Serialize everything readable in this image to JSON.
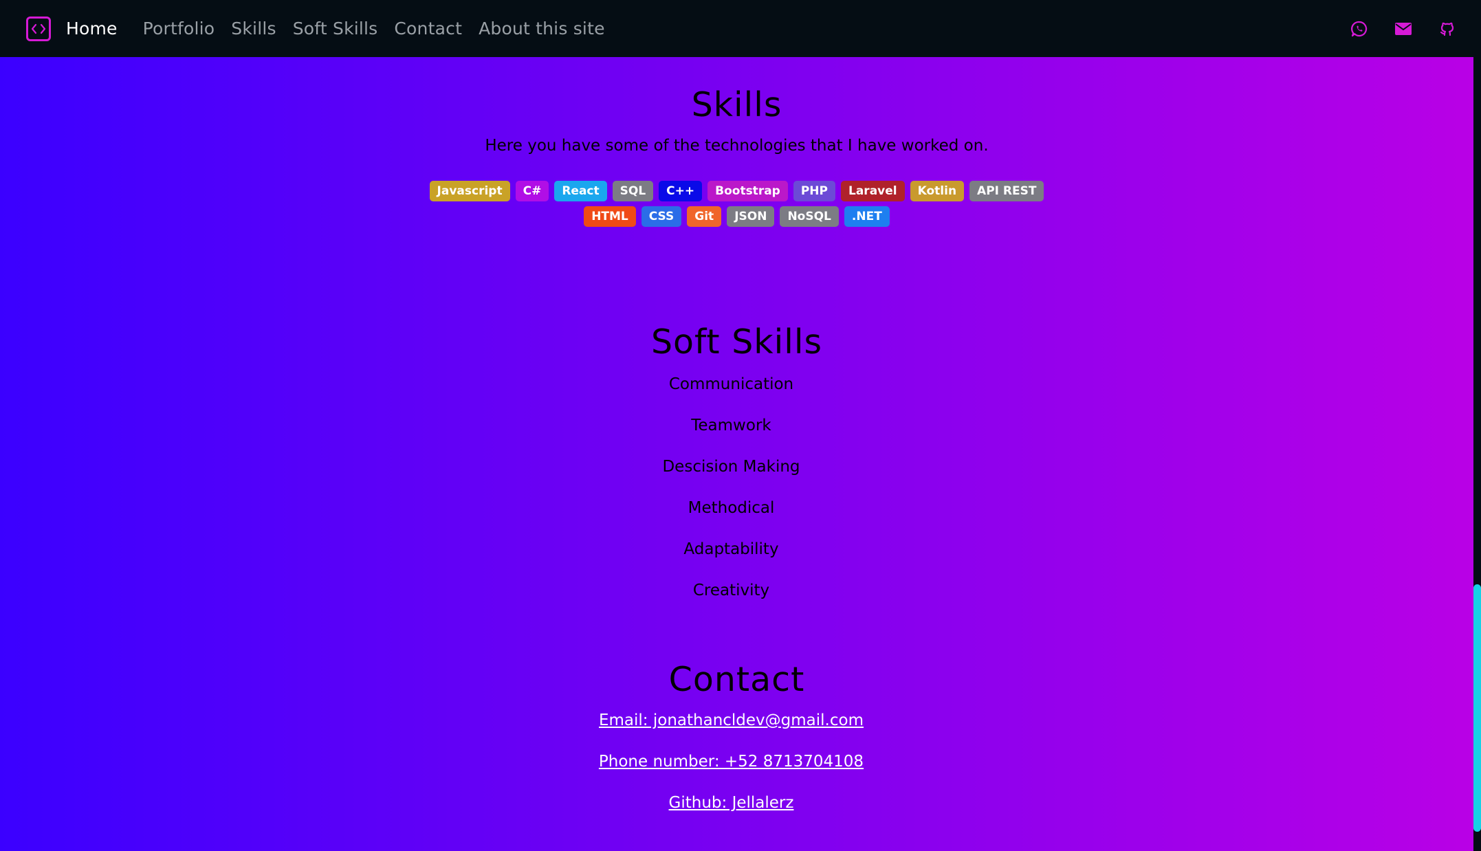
{
  "navbar": {
    "home": "Home",
    "links": [
      "Portfolio",
      "Skills",
      "Soft Skills",
      "Contact",
      "About this site"
    ],
    "icons": [
      "whatsapp-icon",
      "mail-icon",
      "github-icon"
    ],
    "icon_color": "#d61ad6"
  },
  "skills": {
    "title": "Skills",
    "subtitle": "Here you have some of the technologies that I have worked on.",
    "badges_row1": [
      {
        "label": "Javascript",
        "color": "#c9a227"
      },
      {
        "label": "C#",
        "color": "#b10ee6"
      },
      {
        "label": "React",
        "color": "#1aa7ee"
      },
      {
        "label": "SQL",
        "color": "#7c7c84"
      },
      {
        "label": "C++",
        "color": "#0a0ae8"
      },
      {
        "label": "Bootstrap",
        "color": "#bb18c9"
      },
      {
        "label": "PHP",
        "color": "#6c4ad6"
      },
      {
        "label": "Laravel",
        "color": "#b0222a"
      },
      {
        "label": "Kotlin",
        "color": "#c99a2e"
      },
      {
        "label": "API REST",
        "color": "#7c7c84"
      }
    ],
    "badges_row2": [
      {
        "label": "HTML",
        "color": "#f04a16"
      },
      {
        "label": "CSS",
        "color": "#2b6de8"
      },
      {
        "label": "Git",
        "color": "#f0652a"
      },
      {
        "label": "JSON",
        "color": "#7c7c84"
      },
      {
        "label": "NoSQL",
        "color": "#7c7c84"
      },
      {
        "label": ".NET",
        "color": "#1e7ff0"
      }
    ]
  },
  "soft_skills": {
    "title": "Soft Skills",
    "items": [
      "Communication",
      "Teamwork",
      "Descision Making",
      "Methodical",
      "Adaptability",
      "Creativity"
    ]
  },
  "contact": {
    "title": "Contact",
    "email": "Email: jonathancldev@gmail.com",
    "phone": "Phone number: +52 8713704108",
    "github": "Github: Jellalerz"
  },
  "colors": {
    "gradient_start": "#3b00ff",
    "gradient_end": "#b900e6",
    "navbar_bg": "#050d14",
    "scrollbar": "#16d2e6"
  }
}
